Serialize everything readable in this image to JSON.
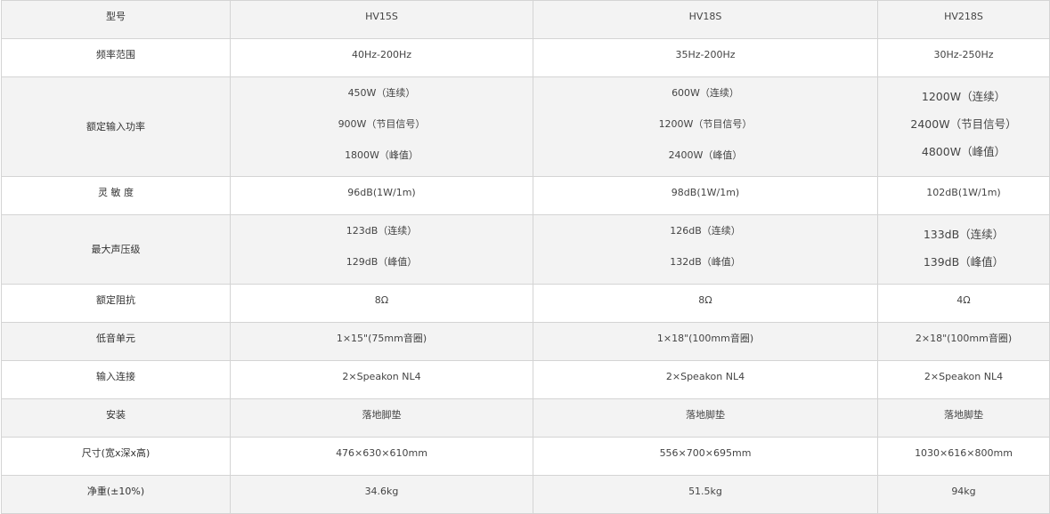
{
  "table": {
    "header": {
      "label": "型号",
      "models": [
        "HV15S",
        "HV18S",
        "HV218S"
      ]
    },
    "rows": [
      {
        "label": "频率范围",
        "values": [
          [
            "40Hz-200Hz"
          ],
          [
            "35Hz-200Hz"
          ],
          [
            "30Hz-250Hz"
          ]
        ]
      },
      {
        "label": "额定输入功率",
        "values": [
          [
            "450W（连续）",
            "900W（节目信号）",
            "1800W（峰值）"
          ],
          [
            "600W（连续）",
            "1200W（节目信号）",
            "2400W（峰值）"
          ],
          [
            "1200W（连续）",
            "2400W（节目信号）",
            "4800W（峰值）"
          ]
        ]
      },
      {
        "label": "灵 敏 度",
        "values": [
          [
            "96dB(1W/1m)"
          ],
          [
            "98dB(1W/1m)"
          ],
          [
            "102dB(1W/1m)"
          ]
        ]
      },
      {
        "label": "最大声压级",
        "values": [
          [
            "123dB（连续）",
            "129dB（峰值）"
          ],
          [
            "126dB（连续）",
            "132dB（峰值）"
          ],
          [
            "133dB（连续）",
            "139dB（峰值）"
          ]
        ]
      },
      {
        "label": "额定阻抗",
        "values": [
          [
            "8Ω"
          ],
          [
            "8Ω"
          ],
          [
            "4Ω"
          ]
        ]
      },
      {
        "label": "低音单元",
        "values": [
          [
            "1×15\"(75mm音圈)"
          ],
          [
            "1×18\"(100mm音圈)"
          ],
          [
            "2×18\"(100mm音圈)"
          ]
        ]
      },
      {
        "label": "输入连接",
        "values": [
          [
            "2×Speakon NL4"
          ],
          [
            "2×Speakon NL4"
          ],
          [
            "2×Speakon NL4"
          ]
        ]
      },
      {
        "label": "安装",
        "values": [
          [
            "落地脚垫"
          ],
          [
            "落地脚垫"
          ],
          [
            "落地脚垫"
          ]
        ]
      },
      {
        "label": "尺寸(宽x深x高)",
        "values": [
          [
            "476×630×610mm"
          ],
          [
            "556×700×695mm"
          ],
          [
            "1030×616×800mm"
          ]
        ]
      },
      {
        "label": "净重(±10%)",
        "values": [
          [
            "34.6kg"
          ],
          [
            "51.5kg"
          ],
          [
            "94kg"
          ]
        ]
      }
    ]
  }
}
